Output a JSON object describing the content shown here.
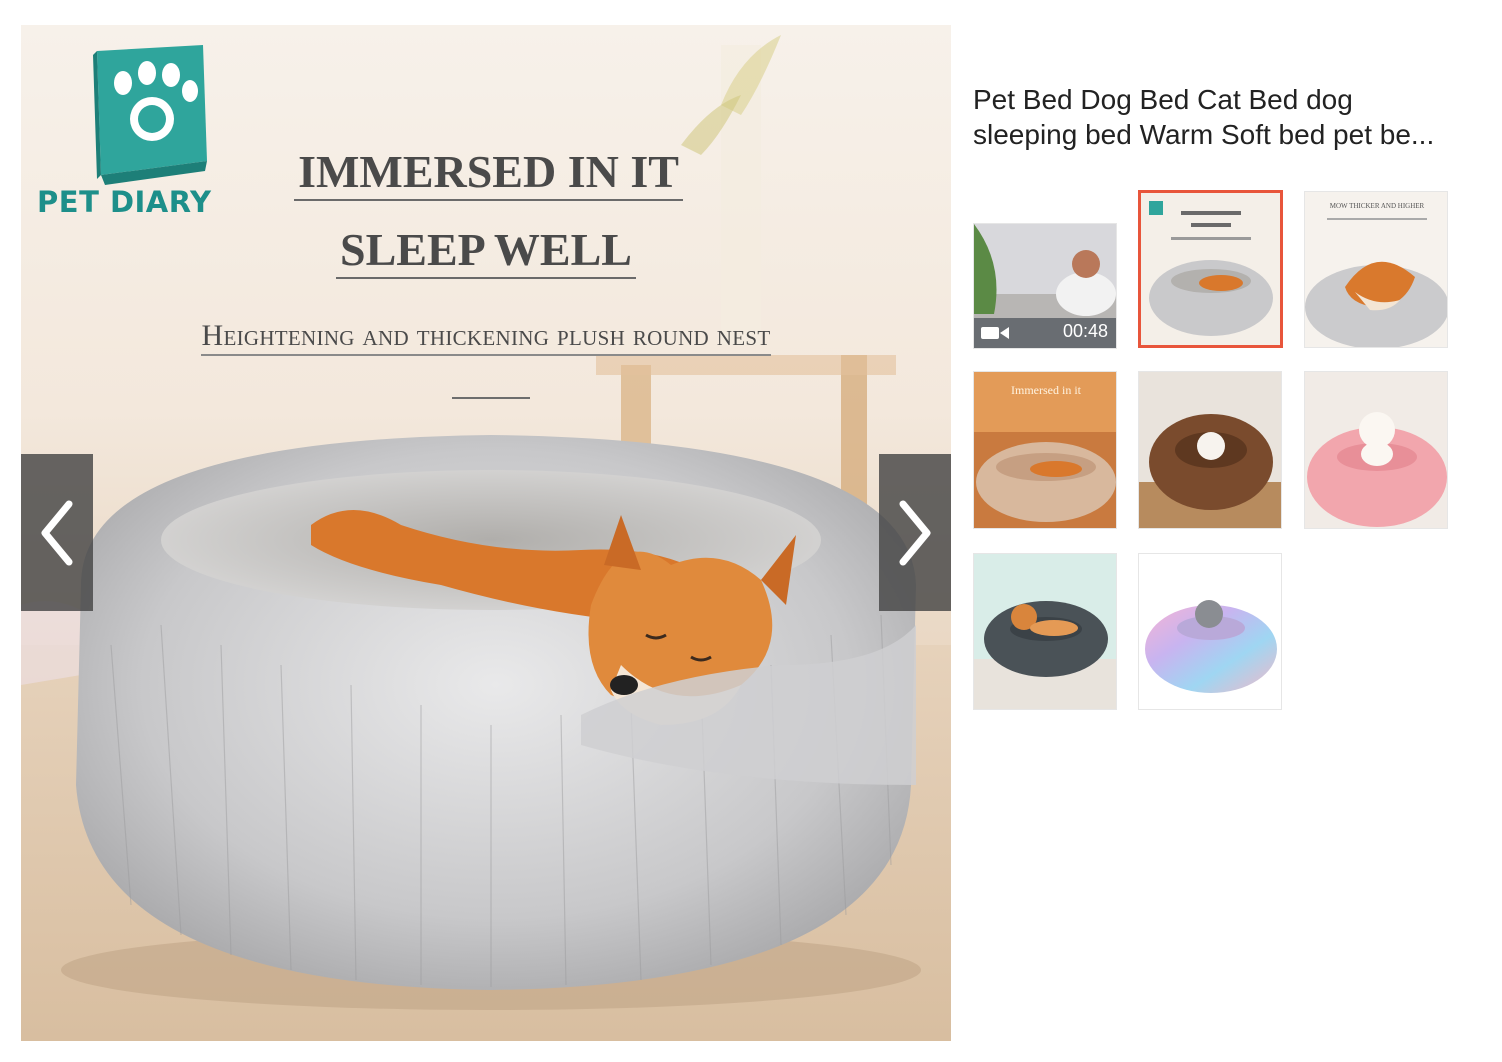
{
  "main_image": {
    "brand_name": "PET DIARY",
    "headline_1": "IMMERSED IN IT",
    "headline_2": "SLEEP WELL",
    "subline": "Heightening and thickening plush round nest"
  },
  "product": {
    "title_line_1": "Pet Bed Dog Bed Cat Bed dog",
    "title_line_2": "sleeping bed Warm Soft bed pet be..."
  },
  "thumbnails": {
    "video_duration": "00:48",
    "t3_heading": "MOW THICKER AND HIGHER",
    "t4_heading": "Immersed in it",
    "items": [
      {
        "kind": "video"
      },
      {
        "kind": "image",
        "selected": true
      },
      {
        "kind": "image"
      },
      {
        "kind": "image"
      },
      {
        "kind": "image"
      },
      {
        "kind": "image"
      },
      {
        "kind": "image"
      },
      {
        "kind": "image"
      }
    ]
  },
  "colors": {
    "selected_border": "#e8553b",
    "brand_teal": "#1d8f8a",
    "nav_arrow_bg": "#464646"
  },
  "icons": [
    "paw-book-logo-icon",
    "chevron-left-icon",
    "chevron-right-icon",
    "video-icon"
  ]
}
